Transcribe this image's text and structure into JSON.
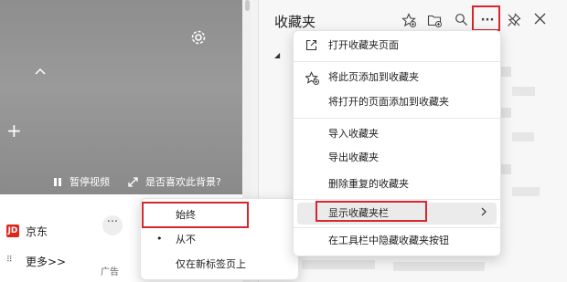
{
  "newtab": {
    "video_pause_label": "暂停视频",
    "bg_feedback_label": "是否喜欢此背景?",
    "shortcuts": [
      {
        "icon_text": "JD",
        "label": "京东"
      }
    ],
    "more_label": "更多>>",
    "ad_label": "广告"
  },
  "favorites": {
    "title": "收藏夹",
    "toolbar_icons": [
      "add-favorite-icon",
      "add-folder-icon",
      "search-icon",
      "more-options-icon",
      "pin-icon",
      "close-icon"
    ],
    "more_button_text": "···",
    "menu": {
      "items": [
        {
          "label": "打开收藏夹页面",
          "icon": "open-external-icon"
        },
        {
          "label": "将此页添加到收藏夹",
          "icon": "star-add-icon"
        },
        {
          "label": "将打开的页面添加到收藏夹",
          "icon": ""
        },
        {
          "label": "导入收藏夹",
          "icon": ""
        },
        {
          "label": "导出收藏夹",
          "icon": ""
        },
        {
          "label": "删除重复的收藏夹",
          "icon": ""
        },
        {
          "label": "显示收藏夹栏",
          "icon": "",
          "has_submenu": true
        },
        {
          "label": "在工具栏中隐藏收藏夹按钮",
          "icon": ""
        }
      ]
    },
    "submenu": {
      "items": [
        {
          "label": "始终",
          "selected": false
        },
        {
          "label": "从不",
          "selected": true
        },
        {
          "label": "仅在新标签页上",
          "selected": false
        }
      ],
      "bullet": "•"
    }
  },
  "colors": {
    "highlight_red": "#d6262e",
    "jd_red": "#e1251b"
  }
}
